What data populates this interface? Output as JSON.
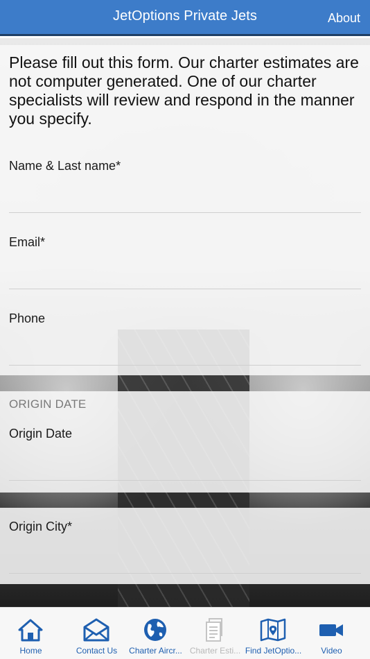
{
  "header": {
    "title": "JetOptions Private Jets",
    "about_label": "About"
  },
  "intro_text": "Please fill out this form. Our charter estimates are not computer generated. One of our charter specialists will review and respond in the manner you specify.",
  "fields": {
    "name_label": "Name & Last name*",
    "email_label": "Email*",
    "phone_label": "Phone",
    "origin_section": "ORIGIN DATE",
    "origin_date_label": "Origin Date",
    "origin_city_label": "Origin City*"
  },
  "tabs": [
    {
      "label": "Home",
      "icon": "home-icon",
      "enabled": true
    },
    {
      "label": "Contact Us",
      "icon": "envelope-icon",
      "enabled": true
    },
    {
      "label": "Charter Aircr...",
      "icon": "globe-icon",
      "enabled": true
    },
    {
      "label": "Charter Esti...",
      "icon": "document-icon",
      "enabled": false
    },
    {
      "label": "Find JetOptio...",
      "icon": "map-pin-icon",
      "enabled": true
    },
    {
      "label": "Video",
      "icon": "video-camera-icon",
      "enabled": true
    }
  ],
  "colors": {
    "header": "#3d7cc9",
    "tab_active": "#1e5fb0",
    "tab_disabled": "#b8b8b8"
  }
}
